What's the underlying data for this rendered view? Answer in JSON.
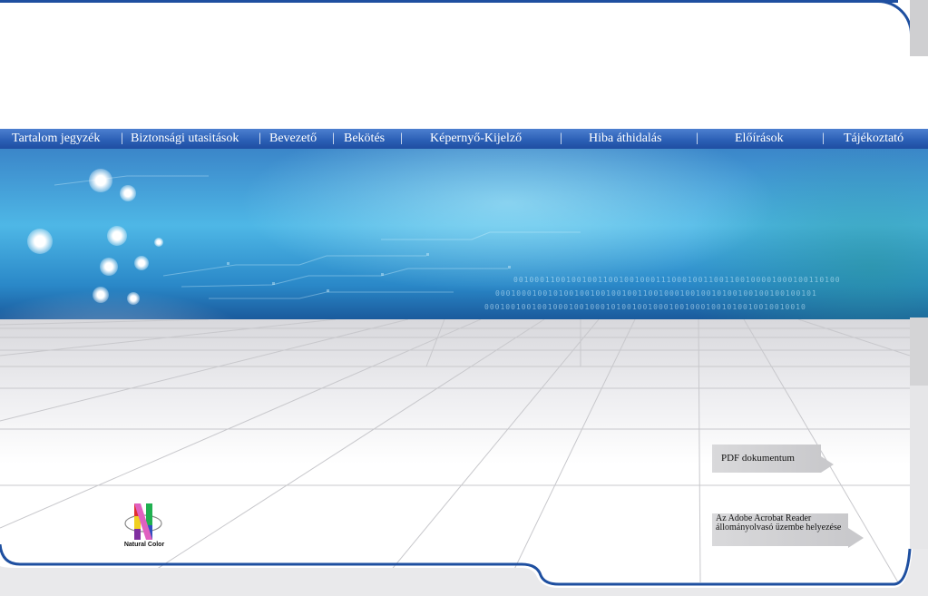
{
  "nav": {
    "items": [
      {
        "label": "Tartalom jegyzék"
      },
      {
        "label": "Biztonsági utasitások"
      },
      {
        "label": "Bevezető"
      },
      {
        "label": "Bekötés"
      },
      {
        "label": "Képernyő-Kijelző"
      },
      {
        "label": "Hiba áthidalás"
      },
      {
        "label": "Előírások"
      },
      {
        "label": "Tájékoztató"
      }
    ],
    "separator": "|"
  },
  "banner": {
    "binary_lines": [
      "00100011001001001100100100011100010011001100100001000100110100",
      "0001000100101001001001001001100100010010010100100100100100101",
      "0001001001001000100100010100100100010010001001010010010010010"
    ]
  },
  "links": {
    "pdf_document": "PDF dokumentum",
    "acrobat_install": "Az Adobe Acrobat Reader állományolvasó üzembe helyezése"
  },
  "logo": {
    "text": "Natural Color"
  },
  "colors": {
    "frame_blue": "#1e4fa0",
    "nav_blue": "#2a5eb4",
    "tag_gray": "#d0d0d2"
  }
}
